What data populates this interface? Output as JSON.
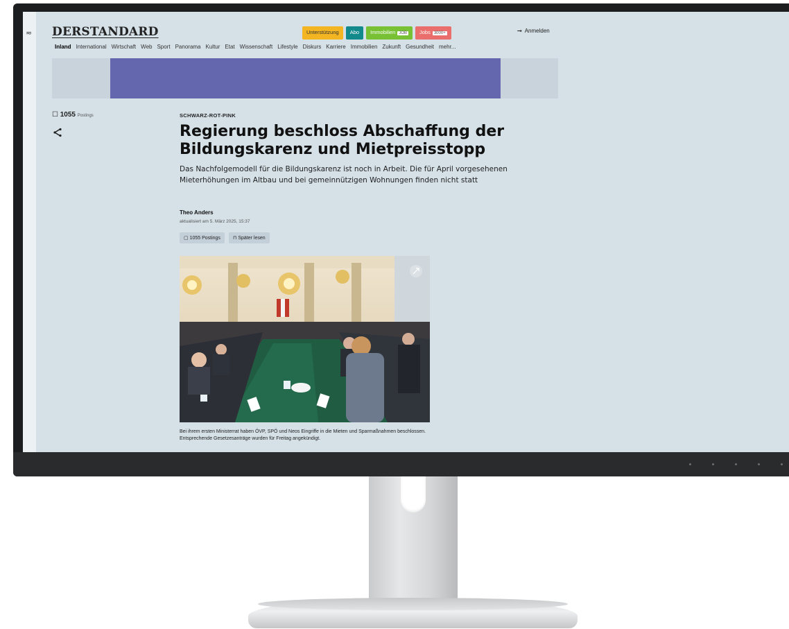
{
  "header": {
    "logo": "DERSTANDARD",
    "pills": [
      {
        "label": "Unterstützung",
        "color": "#f3b521",
        "textColor": "#333333",
        "tag": ""
      },
      {
        "label": "Abo",
        "color": "#12898b",
        "textColor": "#ffffff",
        "tag": ""
      },
      {
        "label": "Immobilien",
        "color": "#78c135",
        "textColor": "#ffffff",
        "tag": "JOB"
      },
      {
        "label": "Jobs",
        "color": "#ea6e6b",
        "textColor": "#ffffff",
        "tag": "3000+"
      }
    ],
    "login_label": "Anmelden"
  },
  "nav": {
    "items": [
      "Inland",
      "International",
      "Wirtschaft",
      "Web",
      "Sport",
      "Panorama",
      "Kultur",
      "Etat",
      "Wissenschaft",
      "Lifestyle",
      "Diskurs",
      "Karriere",
      "Immobilien",
      "Zukunft",
      "Gesundheit",
      "mehr..."
    ],
    "active": "Inland"
  },
  "sidebar": {
    "count": "1055",
    "count_label": "Postings"
  },
  "article": {
    "kicker": "SCHWARZ-ROT-PINK",
    "headline": "Regierung beschloss Abschaffung der Bildungskarenz und Mietpreisstopp",
    "lead": "Das Nachfolgemodell für die Bildungskarenz ist noch in Arbeit. Die für April vorgesehenen Mieterhöhungen im Altbau und bei gemeinnützigen Wohnungen finden nicht statt",
    "author": "Theo Anders",
    "updated": "aktualisiert am 5. März 2025, 15:37",
    "postings_button": "1055 Postings",
    "later_button": "Später lesen",
    "caption": "Bei ihrem ersten Ministerrat haben ÖVP, SPÖ und Neos Eingriffe in die Mieten und Sparmaßnahmen beschlossen. Entsprechende Gesetzesanträge wurden für Freitag angekündigt."
  },
  "colors": {
    "page_bg": "#d5e0e7",
    "ad": "#6567ae",
    "bezel": "#1c1d1f"
  }
}
